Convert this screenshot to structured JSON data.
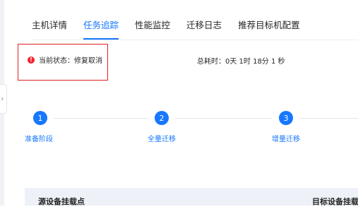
{
  "tabs": [
    "主机详情",
    "任务追踪",
    "性能监控",
    "迁移日志",
    "推荐目标机配置"
  ],
  "active_tab": "任务追踪",
  "status": {
    "text": "当前状态：修复取消",
    "color": "#f5222d"
  },
  "duration": "总耗时：0天 1时 18分 1 秒",
  "steps": [
    {
      "number": "1",
      "label": "准备阶段"
    },
    {
      "number": "2",
      "label": "全量迁移"
    },
    {
      "number": "3",
      "label": "增量迁移"
    }
  ],
  "table": {
    "headers": [
      "源设备挂载点",
      "目标设备挂载"
    ]
  },
  "colors": {
    "accent": "#1677ff",
    "highlight_box": "#e02020"
  },
  "icons": {
    "status": "exclamation-circle-icon",
    "collapse": "chevron-right-icon"
  }
}
